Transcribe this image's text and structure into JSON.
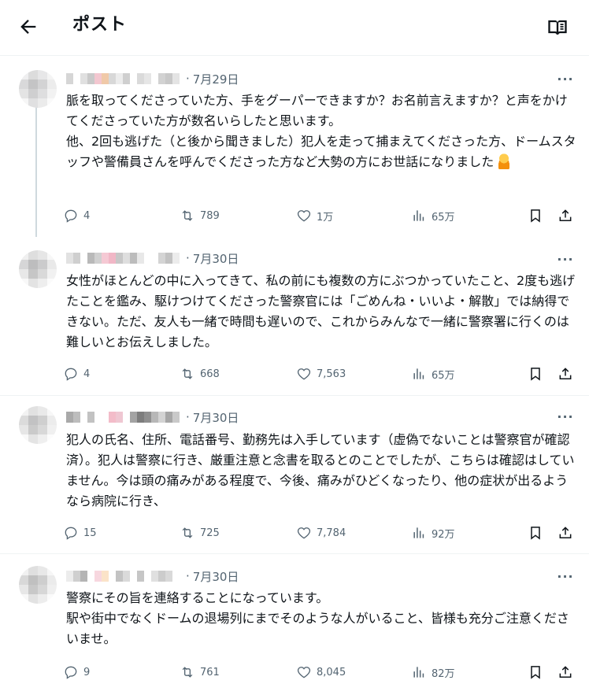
{
  "header": {
    "title": "ポスト",
    "back_icon": "arrow-left-icon",
    "reader_icon": "book-open-icon"
  },
  "posts": [
    {
      "time": "7月29日",
      "text": "脈を取ってくださっていた方、手をグーパーできますか？お名前言えますか？と声をかけてくださっていた方が数名いらしたと思います。\n他、2回も逃げた（と後から聞きました）犯人を走って捕まえてくださった方、ドームスタッフや警備員さんを呼んでくださった方など大勢の方にお世話になりました",
      "emoji": "person-bowing-emoji",
      "replies": "4",
      "reposts": "789",
      "likes": "1万",
      "views": "65万"
    },
    {
      "time": "7月30日",
      "text": "女性がほとんどの中に入ってきて、私の前にも複数の方にぶつかっていたこと、2度も逃げたことを鑑み、駆けつけてくださった警察官には「ごめんね・いいよ・解散」では納得できない。ただ、友人も一緒で時間も遅いので、これからみんなで一緒に警察署に行くのは難しいとお伝えしました。",
      "replies": "4",
      "reposts": "668",
      "likes": "7,563",
      "views": "65万"
    },
    {
      "time": "7月30日",
      "text": "犯人の氏名、住所、電話番号、勤務先は入手しています（虚偽でないことは警察官が確認済）。犯人は警察に行き、厳重注意と念書を取るとのことでしたが、こちらは確認はしていません。今は頭の痛みがある程度で、今後、痛みがひどくなったり、他の症状が出るようなら病院に行き、",
      "replies": "15",
      "reposts": "725",
      "likes": "7,784",
      "views": "92万"
    },
    {
      "time": "7月30日",
      "text": "警察にその旨を連絡することになっています。\n駅や街中でなくドームの退場列にまでそのような人がいること、皆様も充分ご注意くださいませ。",
      "replies": "9",
      "reposts": "761",
      "likes": "8,045",
      "views": "82万"
    }
  ],
  "colors": {
    "text": "#0f1419",
    "secondary": "#536471",
    "thread_line": "#cfd9de",
    "divider": "#eff3f4"
  }
}
